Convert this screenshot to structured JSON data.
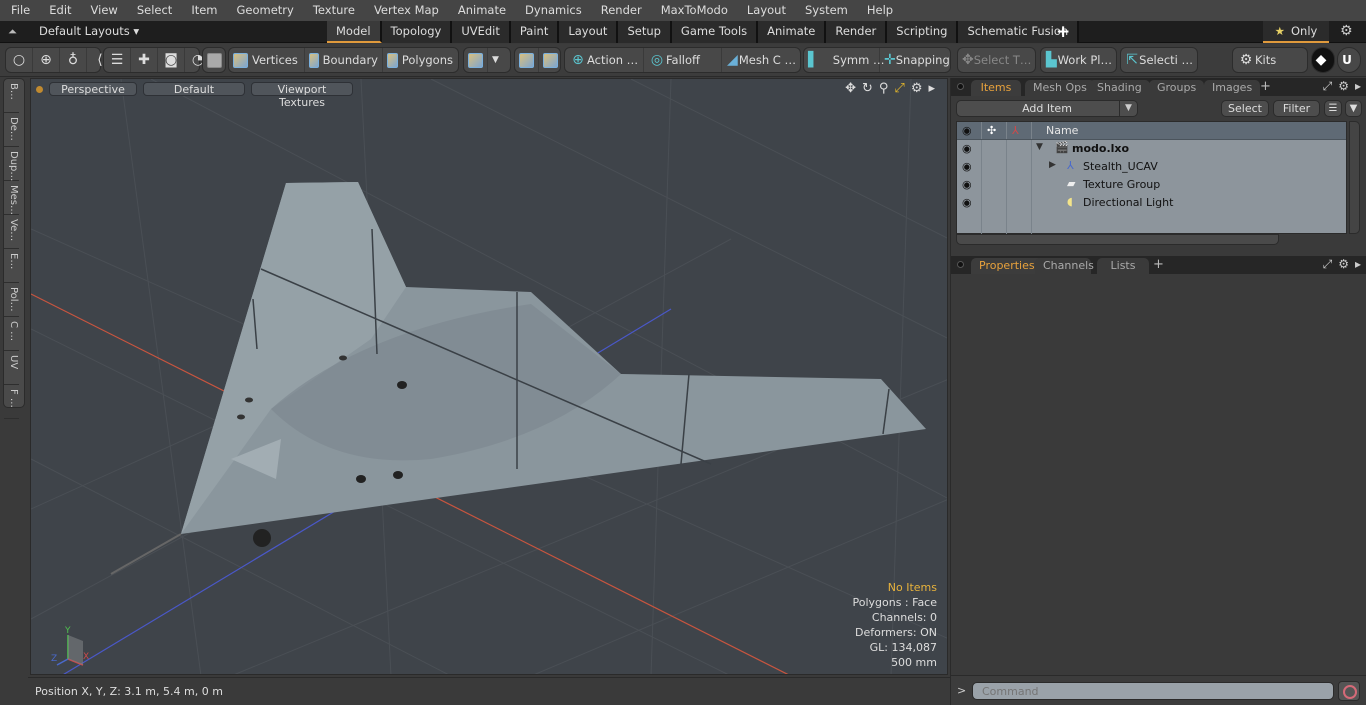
{
  "menu": [
    "File",
    "Edit",
    "View",
    "Select",
    "Item",
    "Geometry",
    "Texture",
    "Vertex Map",
    "Animate",
    "Dynamics",
    "Render",
    "MaxToModo",
    "Layout",
    "System",
    "Help"
  ],
  "layoutbar": {
    "layouts_label": "Default Layouts ▾",
    "tabs": [
      "Model",
      "Topology",
      "UVEdit",
      "Paint",
      "Layout",
      "Setup",
      "Game Tools",
      "Animate",
      "Render",
      "Scripting",
      "Schematic Fusion"
    ],
    "active_tab": "Model",
    "add_tab": "+",
    "only_label": "Only"
  },
  "toolbar": {
    "vertices": "Vertices",
    "boundary": "Boundary",
    "polygons": "Polygons",
    "action": "Action   …",
    "falloff": "Falloff",
    "mesh_c": "Mesh C …",
    "symm": "Symm …",
    "snapping": "Snapping",
    "select_t": "Select T…",
    "work_pl": "Work Pl…",
    "selecti": "Selecti …",
    "kits": "Kits"
  },
  "left_tools": [
    "B…",
    "De…",
    "Dup…",
    "Mes…",
    "Ve…",
    "E…",
    "Pol…",
    "C …",
    "UV",
    "F …"
  ],
  "viewport": {
    "view": "Perspective",
    "style": "Default",
    "textures": "Viewport Textures",
    "info": {
      "selection": "No Items",
      "polygons": "Polygons : Face",
      "channels": "Channels: 0",
      "deformers": "Deformers: ON",
      "gl": "GL: 134,087",
      "grid": "500 mm"
    },
    "axis": {
      "x": "X",
      "y": "Y",
      "z": "Z"
    },
    "colors": {
      "x_axis": "#c8553f",
      "z_axis": "#4a58c8",
      "mesh": "#8a969d"
    }
  },
  "status": {
    "position": "Position X, Y, Z:   3.1 m, 5.4 m, 0 m"
  },
  "items_panel": {
    "tabs": [
      "Items",
      "Mesh Ops",
      "Shading",
      "Groups",
      "Images"
    ],
    "active_tab": "Items",
    "add_item": "Add Item",
    "select": "Select",
    "filter": "Filter",
    "column_name": "Name",
    "rows": [
      {
        "name": "modo.lxo",
        "icon": "scene-icon",
        "bold": true
      },
      {
        "name": "Stealth_UCAV",
        "icon": "locator-icon",
        "bold": false
      },
      {
        "name": "Texture Group",
        "icon": "folder-icon",
        "bold": false
      },
      {
        "name": "Directional Light",
        "icon": "light-icon",
        "bold": false
      }
    ]
  },
  "props_panel": {
    "tabs": [
      "Properties",
      "Channels",
      "Lists"
    ],
    "active_tab": "Properties"
  },
  "command": {
    "prompt": ">",
    "placeholder": "Command"
  }
}
